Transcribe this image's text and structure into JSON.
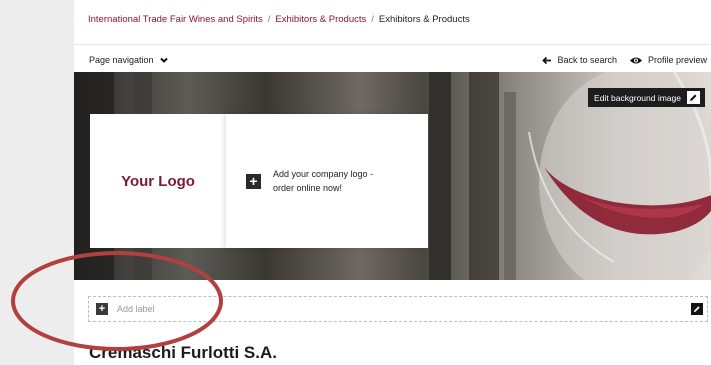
{
  "breadcrumb": {
    "items": [
      "International Trade Fair Wines and Spirits",
      "Exhibitors & Products"
    ],
    "current": "Exhibitors & Products",
    "separator": "/"
  },
  "nav": {
    "page_navigation": "Page navigation",
    "back_to_search": "Back to search",
    "profile_preview": "Profile preview"
  },
  "hero": {
    "edit_background": "Edit background image",
    "logo_placeholder": "Your Logo",
    "add_logo_text": "Add your company logo - order online now!"
  },
  "label_bar": {
    "add_label": "Add label"
  },
  "company": {
    "name": "Cremaschi Furlotti S.A."
  },
  "colors": {
    "brand": "#8a1538",
    "logo_text": "#7b1a3a",
    "annotation_circle": "#b0413e"
  },
  "icons": {
    "page_navigation": "chevron-down-icon",
    "back_to_search": "arrow-left-icon",
    "profile_preview": "eye-icon",
    "edit_background": "pencil-icon",
    "add_logo": "plus-icon",
    "add_label": "plus-icon",
    "edit_label": "pencil-icon"
  }
}
